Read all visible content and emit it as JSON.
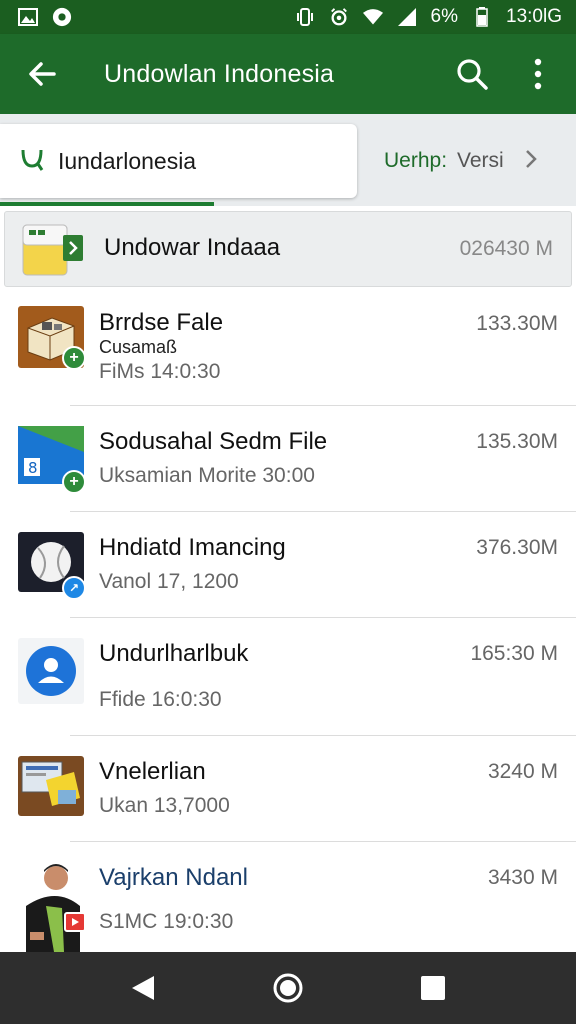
{
  "status_bar": {
    "left_icons": [
      "image-icon",
      "record-icon"
    ],
    "right_icons": [
      "vibrate-icon",
      "alarm-icon",
      "wifi-icon",
      "signal-icon"
    ],
    "battery_text": "6%",
    "time": "13:0lG"
  },
  "app_bar": {
    "title": "Undowlan Indonesia",
    "back_icon": "arrow-back-icon",
    "search_icon": "search-icon",
    "menu_icon": "more-vert-icon",
    "color": "#1e6b2a"
  },
  "tabs": {
    "active_label": "Iundarlonesia",
    "other_label_a": "Uerhp:",
    "other_label_b": "Versi"
  },
  "rows": [
    {
      "title": "Undowar Indaaa",
      "size": "026430 M"
    },
    {
      "title": "Brrdse Fale",
      "subtitle": "Cusamaß",
      "meta": "FiMs 14:0:30",
      "size": "133.30M"
    },
    {
      "title": "Sodusahal Sedm File",
      "meta": "Uksamian Morite 30:00",
      "size": "135.30M"
    },
    {
      "title": "Hndiatd Imancing",
      "meta": "Vanol 17, 1200",
      "size": "376.30M"
    },
    {
      "title": "Undurlharlbuk",
      "meta": "Ffide 16:0:30",
      "size": "165:30 M"
    },
    {
      "title": "Vnelerlian",
      "meta": "Ukan 13,7000",
      "size": "3240 M"
    },
    {
      "title": "Vajrkan Ndanl",
      "meta": "S1MC 19:0:30",
      "size": "3430 M"
    }
  ],
  "nav": {
    "back": "nav-back-icon",
    "home": "nav-home-icon",
    "recents": "nav-recents-icon"
  }
}
